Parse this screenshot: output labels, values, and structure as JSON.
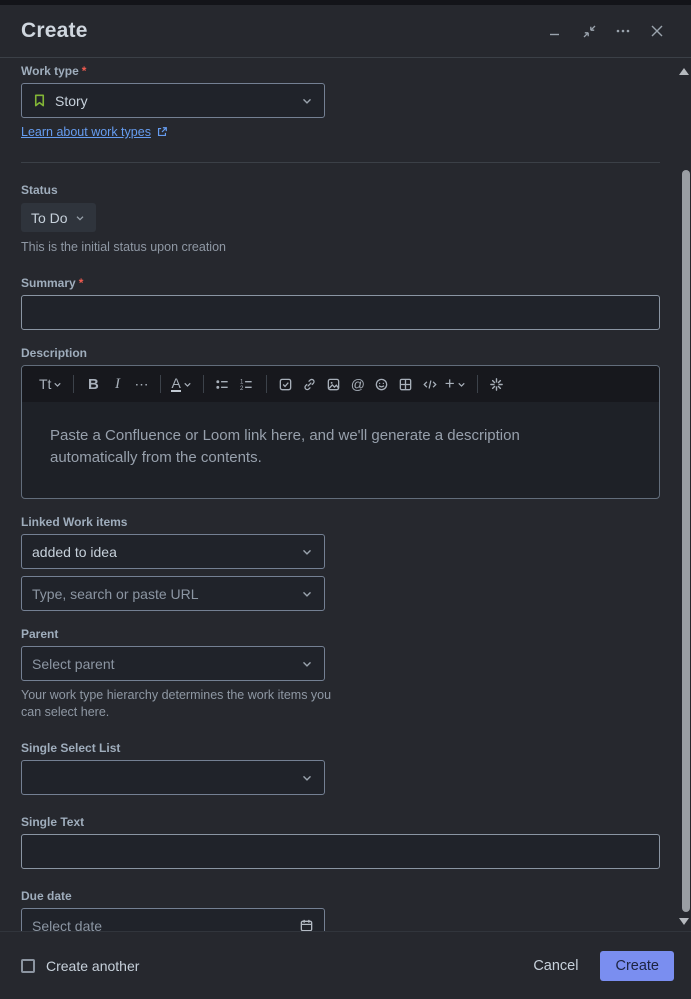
{
  "window": {
    "title": "Create",
    "controls": {
      "minimize": "minimize",
      "exit_fullscreen": "exit-fullscreen",
      "more": "more-options",
      "close": "close"
    }
  },
  "required_mark": "*",
  "form": {
    "work_type": {
      "label": "Work type",
      "required": true,
      "value": "Story",
      "icon": "story-bookmark-icon",
      "icon_color": "#82B536",
      "link_label": "Learn about work types"
    },
    "status": {
      "label": "Status",
      "value": "To Do",
      "helper": "This is the initial status upon creation"
    },
    "summary": {
      "label": "Summary",
      "required": true,
      "value": ""
    },
    "description": {
      "label": "Description",
      "placeholder": "Paste a Confluence or Loom link here, and we'll generate a description automatically from the contents.",
      "toolbar_glyphs": {
        "text_styles": "Tt",
        "bold": "B",
        "italic": "I",
        "more": "⋯",
        "text_color": "A",
        "mention": "@",
        "code": "</>",
        "insert_plus": "+"
      },
      "toolbar_icons": [
        "text-styles",
        "bold",
        "italic",
        "more-formatting",
        "text-color",
        "bullet-list",
        "numbered-list",
        "task-list",
        "link",
        "image",
        "mention",
        "emoji",
        "table",
        "code",
        "insert",
        "ai-sparkle"
      ]
    },
    "linked_work_items": {
      "label": "Linked Work items",
      "link_type_value": "added to idea",
      "search_placeholder": "Type, search or paste URL"
    },
    "parent": {
      "label": "Parent",
      "placeholder": "Select parent",
      "helper": "Your work type hierarchy determines the work items you can select here."
    },
    "single_select": {
      "label": "Single Select List",
      "value": ""
    },
    "single_text": {
      "label": "Single Text",
      "value": ""
    },
    "due_date": {
      "label": "Due date",
      "placeholder": "Select date",
      "icon": "calendar-icon"
    }
  },
  "footer": {
    "create_another_label": "Create another",
    "create_another_checked": false,
    "cancel_label": "Cancel",
    "create_label": "Create"
  },
  "colors": {
    "modal_bg": "#26282E",
    "primary_button_bg": "#7A8EF0",
    "primary_button_text": "#1C2340",
    "link": "#669DF1",
    "required_asterisk": "#F15B50",
    "story_icon_green": "#82B536"
  }
}
